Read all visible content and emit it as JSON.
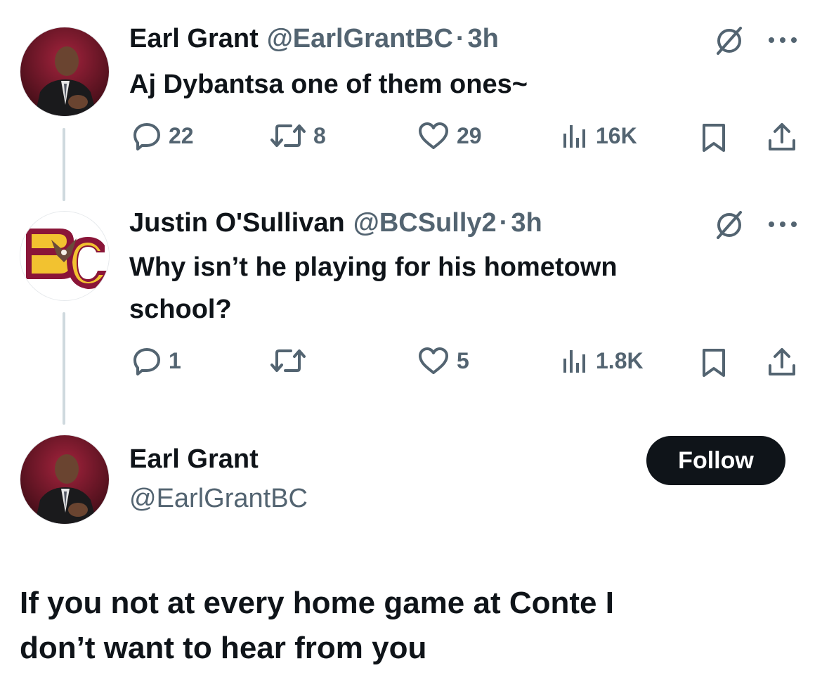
{
  "tweet1": {
    "author_name": "Earl Grant",
    "handle": "@EarlGrantBC",
    "sep": "·",
    "time": "3h",
    "text": "Aj Dybantsa one of them ones~",
    "replies": "22",
    "retweets": "8",
    "likes": "29",
    "views": "16K"
  },
  "tweet2": {
    "author_name": "Justin O'Sullivan",
    "handle": "@BCSully2",
    "sep": "·",
    "time": "3h",
    "text_line1": "Why isn’t he playing for his hometown",
    "text_line2": "school?",
    "replies": "1",
    "retweets": "",
    "likes": "5",
    "views": "1.8K"
  },
  "main_tweet": {
    "author_name": "Earl Grant",
    "handle": "@EarlGrantBC",
    "follow_label": "Follow",
    "text_line1": "If you not at every home game at Conte I",
    "text_line2": "don’t want to hear from you"
  },
  "colors": {
    "text": "#0f1419",
    "secondary": "#536471",
    "thread_line": "#cfd9de",
    "bc_maroon": "#8a1538",
    "bc_gold": "#f2c230"
  },
  "icons": [
    "grok-icon",
    "more-icon",
    "reply-icon",
    "retweet-icon",
    "like-icon",
    "views-icon",
    "bookmark-icon",
    "share-icon"
  ]
}
